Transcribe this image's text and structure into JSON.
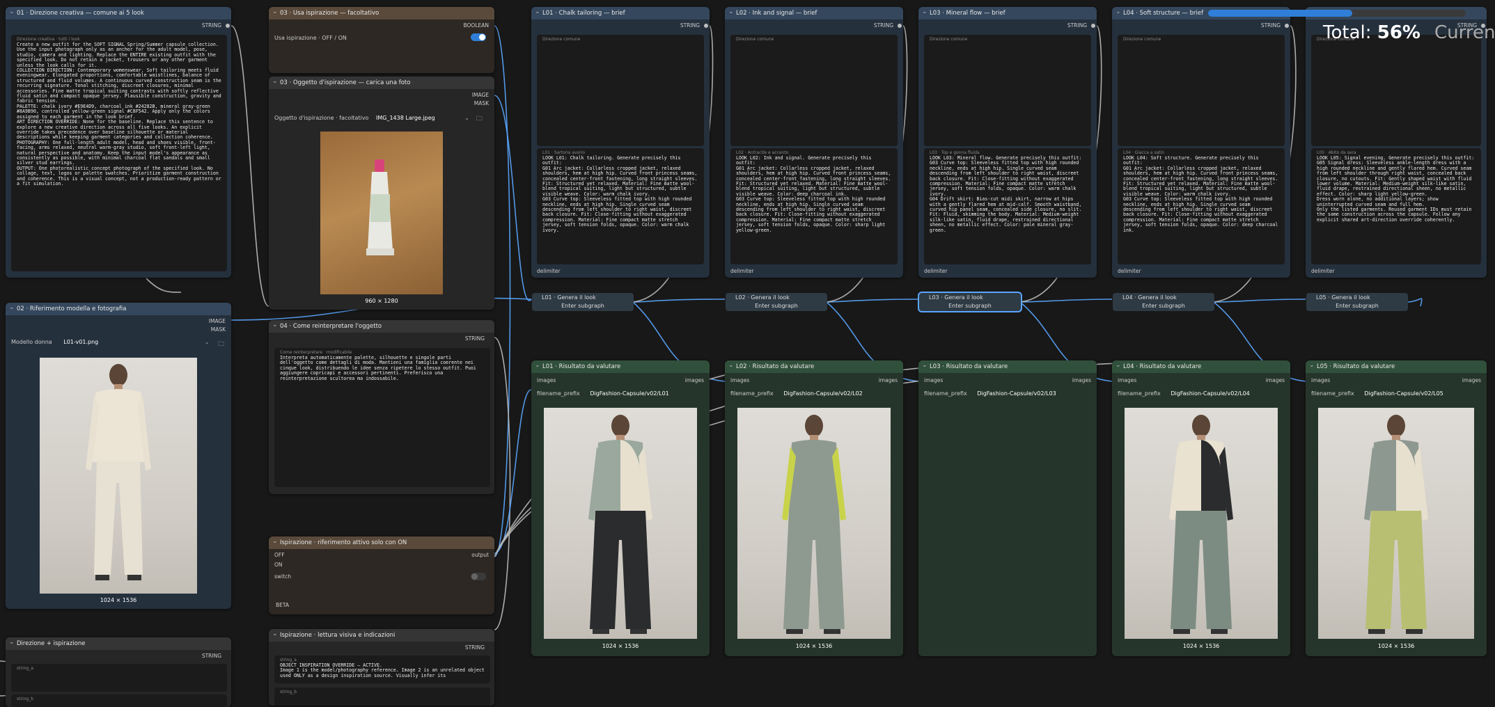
{
  "colors": {
    "wire_blue": "#5aa6ff",
    "wire_gray": "#bdbdbd",
    "toggle_on": "#2f7fd8",
    "progress": "#2f7fd8"
  },
  "progress": {
    "label": "Total:",
    "value": "56%",
    "value_fraction": 0.56,
    "current_label": "Current"
  },
  "n01": {
    "title": "01 · Direzione creativa — comune ai 5 look",
    "out": "STRING",
    "label": "Direzione creativa · tutti i look",
    "text": "Create a new outfit for the SOFT SIGNAL Spring/Summer capsule collection. Use the input photograph only as an anchor for the adult model, pose, studio, camera and lighting. Replace the ENTIRE existing outfit with the specified look. Do not retain a jacket, trousers or any other garment unless the look calls for it.\nCOLLECTION DIRECTION: Contemporary womenswear. Soft tailoring meets fluid eveningwear. Elongated proportions, comfortable waistlines, balance of structured and fluid volumes. A continuous curved construction seam is the recurring signature. Tonal stitching, discreet closures, minimal accessories. Fine matte tropical suiting contrasts with softly reflective fluid satin and compact opaque jersey. Plausible construction, gravity and fabric tension.\nPALETTE: chalk ivory #E9E4D9, charcoal ink #24282B, mineral gray-green #8A9B90, controlled yellow-green signal #C8F542. Apply only the colors assigned to each garment in the look brief.\nART DIRECTION OVERRIDE: None for the baseline. Replace this sentence to explore a new creative direction across all five looks. An explicit override takes precedence over baseline silhouette or material descriptions while keeping garment categories and collection coherence.\nPHOTOGRAPHY: One full-length adult model, head and shoes visible, front-facing, arms relaxed, neutral warm-gray studio, soft front-left light, natural perspective and anatomy. Keep the input model's appearance as consistently as possible, with minimal charcoal flat sandals and small silver stud earrings.\nOUTPUT: One photorealistic concept photograph of the specified look. No collage, text, logos or palette swatches. Prioritize garment construction and coherence. This is a visual concept, not a production-ready pattern or a fit simulation."
  },
  "n02": {
    "title": "02 · Riferimento modella e fotografia",
    "out_image": "IMAGE",
    "out_mask": "MASK",
    "model_label": "Modello donna",
    "model_value": "L01-v01.png",
    "caption": "1024 × 1536"
  },
  "n03a": {
    "title": "03 · Usa ispirazione — facoltativo",
    "out": "BOOLEAN",
    "label": "Usa ispirazione · OFF / ON"
  },
  "n03b": {
    "title": "03 · Oggetto d'ispirazione — carica una foto",
    "out_image": "IMAGE",
    "out_mask": "MASK",
    "label": "Oggetto d'ispirazione · facoltativo",
    "value": "IMG_1438 Large.jpeg",
    "caption": "960 × 1280"
  },
  "n04": {
    "title": "04 · Come reinterpretare l'oggetto",
    "out": "STRING",
    "label": "Come reinterpretare · modificabile",
    "text": "Interpreta automaticamente palette, silhouette e singole parti dell'oggetto come dettagli di moda. Mantieni una famiglia coerente nei cinque look, distribuendo le idee senza ripetere lo stesso outfit. Puoi aggiungere copricapi e accessori pertinenti. Preferisco una reinterpretazione scultorea ma indossabile."
  },
  "nsw": {
    "title": "Ispirazione · riferimento attivo solo con ON",
    "in_off": "OFF",
    "in_on": "ON",
    "in_switch": "switch",
    "out": "output",
    "badge": "BETA"
  },
  "nlv": {
    "title": "Ispirazione · lettura visiva e indicazioni",
    "out": "STRING",
    "label_a": "string_a",
    "text_a": "OBJECT INSPIRATION OVERRIDE — ACTIVE.\nImage 1 is the model/photography reference. Image 2 is an unrelated object used ONLY as a design inspiration source. Visually infer its",
    "label_b": "string_b"
  },
  "ndi": {
    "title": "Direzione + ispirazione",
    "out": "STRING",
    "label_a": "string_a",
    "label_b": "string_b"
  },
  "briefs": [
    {
      "title": "L01 · Chalk tailoring — brief",
      "out": "STRING",
      "common": "Direzione comune",
      "label": "L01 · Sartoria avorio",
      "text": "LOOK L01: Chalk tailoring. Generate precisely this outfit:\nG01 Arc jacket: Collarless cropped jacket, relaxed shoulders, hem at high hip. Curved front princess seams, concealed center-front fastening, long straight sleeves. Fit: Structured yet relaxed. Material: Fine matte wool-blend tropical suiting, light but structured, subtle visible weave. Color: warm chalk ivory.\nG03 Curve top: Sleeveless fitted top with high rounded neckline, ends at high hip. Single curved seam descending from left shoulder to right waist, discreet back closure. Fit: Close-fitting without exaggerated compression. Material: Fine compact matte stretch jersey, soft tension folds, opaque. Color: warm chalk ivory.",
      "delim": "delimiter"
    },
    {
      "title": "L02 · Ink and signal — brief",
      "out": "STRING",
      "common": "Direzione comune",
      "label": "L02 · Antracite e accento",
      "text": "LOOK L02: Ink and signal. Generate precisely this outfit:\nG01 Arc jacket: Collarless cropped jacket, relaxed shoulders, hem at high hip. Curved front princess seams, concealed center-front fastening, long straight sleeves. Fit: Structured yet relaxed. Material: Fine matte wool-blend tropical suiting, light but structured, subtle visible weave. Color: deep charcoal ink.\nG03 Curve top: Sleeveless fitted top with high rounded neckline, ends at high hip. Single curved seam descending from left shoulder to right waist, discreet back closure. Fit: Close-fitting without exaggerated compression. Material: Fine compact matte stretch jersey, soft tension folds, opaque. Color: sharp light yellow-green.",
      "delim": "delimiter"
    },
    {
      "title": "L03 · Mineral flow — brief",
      "out": "STRING",
      "common": "Direzione comune",
      "label": "L03 · Top e gonna fluida",
      "text": "LOOK L03: Mineral flow. Generate precisely this outfit:\nG03 Curve top: Sleeveless fitted top with high rounded neckline, ends at high hip. Single curved seam descending from left shoulder to right waist, discreet back closure. Fit: Close-fitting without exaggerated compression. Material: Fine compact matte stretch jersey, soft tension folds, opaque. Color: warm chalk ivory.\nG04 Drift skirt: Bias-cut midi skirt, narrow at hips with a gently flared hem at mid-calf. Smooth waistband, curved hip panel seam, concealed side closure, no slit. Fit: Fluid, skimming the body. Material: Medium-weight silk-like satin, fluid drape, restrained directional sheen, no metallic effect. Color: pale mineral gray-green.",
      "delim": "delimiter"
    },
    {
      "title": "L04 · Soft structure — brief",
      "out": "STRING",
      "common": "Direzione comune",
      "label": "L04 · Giacca a satin",
      "text": "LOOK L04: Soft structure. Generate precisely this outfit:\nG01 Arc jacket: Collarless cropped jacket, relaxed shoulders, hem at high hip. Curved front princess seams, concealed center-front fastening, long straight sleeves. Fit: Structured yet relaxed. Material: Fine matte wool-blend tropical suiting, light but structured, subtle visible weave. Color: warm chalk ivory.\nG03 Curve top: Sleeveless fitted top with high rounded neckline, ends at high hip. Single curved seam descending from left shoulder to right waist, discreet back closure. Fit: Close-fitting without exaggerated compression. Material: Fine compact matte stretch jersey, soft tension folds, opaque. Color: deep charcoal ink.",
      "delim": "delimiter"
    },
    {
      "title": "",
      "out": "STRING",
      "common": "Direzione comune",
      "label": "L05 · Abito da sera",
      "text": "LOOK L05: Signal evening. Generate precisely this outfit:\nG05 Signal dress: Sleeveless ankle-length dress with a high rounded neckline and gently flared hem. Curved seam from left shoulder through right waist, concealed back closure, no cutouts. Fit: Gently shaped waist with fluid lower volume. Material: Medium-weight silk-like satin, fluid drape, restrained directional sheen, no metallic effect. Color: sharp light yellow-green.\nDress worn alone, no additional layers; show uninterrupted curved seam and full hem.\nOnly the listed garments. Reused garment IDs must retain the same construction across the capsule. Follow any explicit shared art-direction override coherently.",
      "delim": "delimiter"
    }
  ],
  "subgraphs": [
    {
      "title": "L01 · Genera il look",
      "enter": "Enter subgraph"
    },
    {
      "title": "L02 · Genera il look",
      "enter": "Enter subgraph"
    },
    {
      "title": "L03 · Genera il look",
      "enter": "Enter subgraph"
    },
    {
      "title": "L04 · Genera il look",
      "enter": "Enter subgraph"
    },
    {
      "title": "L05 · Genera il look",
      "enter": "Enter subgraph"
    }
  ],
  "results": [
    {
      "title": "L01 · Risultato da valutare",
      "in": "images",
      "out": "images",
      "prefix_label": "filename_prefix",
      "prefix": "DigFashion-Capsule/v02/L01",
      "caption": "1024 × 1536"
    },
    {
      "title": "L02 · Risultato da valutare",
      "in": "images",
      "out": "images",
      "prefix_label": "filename_prefix",
      "prefix": "DigFashion-Capsule/v02/L02",
      "caption": "1024 × 1536"
    },
    {
      "title": "L03 · Risultato da valutare",
      "in": "images",
      "out": "images",
      "prefix_label": "filename_prefix",
      "prefix": "DigFashion-Capsule/v02/L03",
      "caption": ""
    },
    {
      "title": "L04 · Risultato da valutare",
      "in": "images",
      "out": "images",
      "prefix_label": "filename_prefix",
      "prefix": "DigFashion-Capsule/v02/L04",
      "caption": "1024 × 1536"
    },
    {
      "title": "L05 · Risultato da valutare",
      "in": "images",
      "out": "images",
      "prefix_label": "filename_prefix",
      "prefix": "DigFashion-Capsule/v02/L05",
      "caption": "1024 × 1536"
    }
  ]
}
